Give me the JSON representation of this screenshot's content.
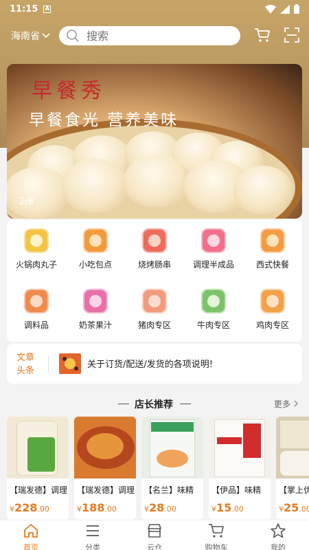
{
  "status_bar": {
    "time": "11:15",
    "app_icon_letter": "A",
    "icons": [
      "wifi-icon",
      "signal-icon",
      "battery-icon"
    ]
  },
  "header": {
    "location": "海南省",
    "search_placeholder": "搜索",
    "icons": [
      "cart-icon",
      "scan-icon"
    ]
  },
  "banner": {
    "title": "早餐秀",
    "subtitle": "早餐食光 营养美味",
    "counter": "2/8"
  },
  "categories": [
    {
      "label": "火锅肉丸子",
      "color": "#f4c445"
    },
    {
      "label": "小吃包点",
      "color": "#f39a3a"
    },
    {
      "label": "烧烤肠串",
      "color": "#ee6b5a"
    },
    {
      "label": "调理半成品",
      "color": "#f26e8a"
    },
    {
      "label": "西式快餐",
      "color": "#f59b42"
    },
    {
      "label": "调料品",
      "color": "#f08a4f"
    },
    {
      "label": "奶茶果汁",
      "color": "#e96fa9"
    },
    {
      "label": "猪肉专区",
      "color": "#f29a7c"
    },
    {
      "label": "牛肉专区",
      "color": "#7cc468"
    },
    {
      "label": "鸡肉专区",
      "color": "#f3a14a"
    }
  ],
  "notice": {
    "tag": "文章头条",
    "text": "关于订货/配送/发货的各项说明!"
  },
  "recommend": {
    "title": "店长推荐",
    "more": "更多",
    "products": [
      {
        "name": "【瑞发德】调理",
        "currency": "¥",
        "price_int": "228",
        "price_dec": ".00",
        "bg": "#f1e9d4",
        "fg": "#58a83f"
      },
      {
        "name": "【瑞发德】调理",
        "currency": "¥",
        "price_int": "188",
        "price_dec": ".00",
        "bg": "#d97b2f",
        "fg": "#b5471e"
      },
      {
        "name": "【名兰】味精",
        "currency": "¥",
        "price_int": "28",
        "price_dec": ".00",
        "bg": "#e8efe6",
        "fg": "#3aa15c"
      },
      {
        "name": "【伊品】味精",
        "currency": "¥",
        "price_int": "15",
        "price_dec": ".00",
        "bg": "#f4f1ec",
        "fg": "#d22b2b"
      },
      {
        "name": "【掌上优",
        "currency": "¥",
        "price_int": "25",
        "price_dec": ".00",
        "bg": "#d9cdb5",
        "fg": "#8a6c45"
      }
    ]
  },
  "tabbar": [
    {
      "label": "首页",
      "icon": "home-icon",
      "active": true
    },
    {
      "label": "分类",
      "icon": "list-icon",
      "active": false
    },
    {
      "label": "云仓",
      "icon": "store-icon",
      "active": false
    },
    {
      "label": "购物车",
      "icon": "cart-icon",
      "active": false
    },
    {
      "label": "我的",
      "icon": "star-icon",
      "active": false
    }
  ]
}
